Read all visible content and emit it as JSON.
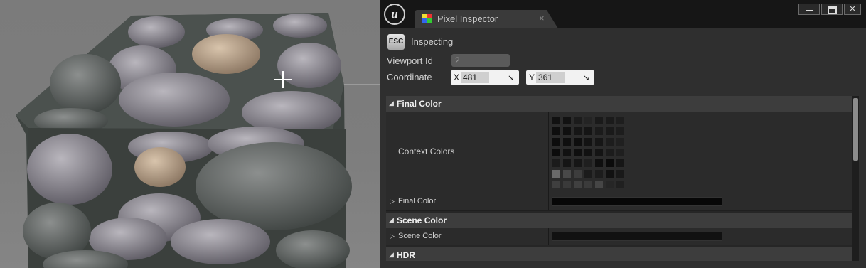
{
  "window": {
    "tab_title": "Pixel Inspector",
    "tab_close": "×",
    "controls": {
      "min": "",
      "max": "",
      "close": "✕"
    },
    "logo": "u"
  },
  "header": {
    "esc_label": "ESC",
    "status": "Inspecting"
  },
  "fields": {
    "viewport_id_label": "Viewport Id",
    "viewport_id_value": "2",
    "coordinate_label": "Coordinate",
    "x_axis": "X",
    "x_value": "481",
    "y_axis": "Y",
    "y_value": "361",
    "arrow": "↘"
  },
  "details": {
    "final_color_category": "Final Color",
    "context_colors_label": "Context Colors",
    "final_color_label": "Final Color",
    "scene_color_category": "Scene Color",
    "scene_color_label": "Scene Color",
    "hdr_category": "HDR",
    "collapse_glyph": "◢",
    "expand_glyph": "▷"
  },
  "context_colors": [
    [
      "#111111",
      "#121212",
      "#1c1c1c",
      "#242424",
      "#1a1a1a",
      "#1b1b1b",
      "#1e1e1e"
    ],
    [
      "#0e0e0e",
      "#101010",
      "#161616",
      "#151515",
      "#1b1b1b",
      "#1a1a1a",
      "#1d1d1d"
    ],
    [
      "#0d0d0d",
      "#0f0f0f",
      "#0e0e0e",
      "#131313",
      "#161616",
      "#1d1d1d",
      "#202020"
    ],
    [
      "#0c0c0c",
      "#111111",
      "#0f0f0f",
      "#111111",
      "#141414",
      "#1c1c1c",
      "#1f1f1f"
    ],
    [
      "#1b1b1b",
      "#151515",
      "#161616",
      "#1f1f1f",
      "#0f0f0f",
      "#0b0b0b",
      "#161616"
    ],
    [
      "#6a6a6a",
      "#494949",
      "#3d3d3d",
      "#1b1b1b",
      "#1c1c1c",
      "#111111",
      "#191919"
    ],
    [
      "#3f3f3f",
      "#3a3a3a",
      "#404040",
      "#3b3b3b",
      "#464646",
      "#262626",
      "#202020"
    ]
  ],
  "colors": {
    "final_color": "#070707",
    "scene_color": "#111111",
    "accent": "#d0d0d0"
  }
}
